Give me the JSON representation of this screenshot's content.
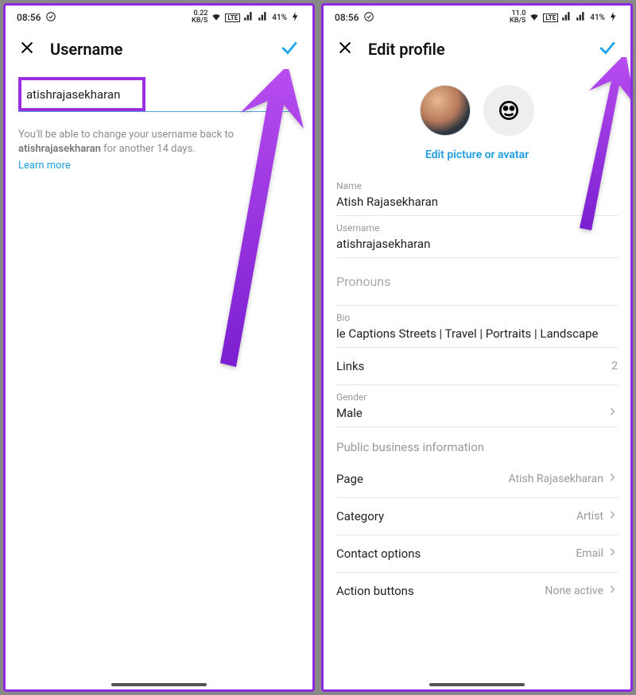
{
  "status": {
    "time": "08:56",
    "speed_left": "0.22",
    "speed_right": "11.0",
    "speed_unit": "KB/S",
    "battery": "41%"
  },
  "left": {
    "title": "Username",
    "username": "atishrajasekharan",
    "hint_prefix": "You'll be able to change your username back to ",
    "hint_bold": "atishrajasekharan",
    "hint_suffix": " for another 14 days.",
    "learn_more": "Learn more"
  },
  "right": {
    "title": "Edit profile",
    "edit_pic": "Edit picture or avatar",
    "fields": {
      "name_label": "Name",
      "name_value": "Atish Rajasekharan",
      "username_label": "Username",
      "username_value": "atishrajasekharan",
      "pronouns_placeholder": "Pronouns",
      "bio_label": "Bio",
      "bio_value": "le Captions Streets | Travel | Portraits | Landscape",
      "links_label": "Links",
      "links_count": "2",
      "gender_label": "Gender",
      "gender_value": "Male",
      "section": "Public business information",
      "page_label": "Page",
      "page_value": "Atish Rajasekharan",
      "category_label": "Category",
      "category_value": "Artist",
      "contact_label": "Contact options",
      "contact_value": "Email",
      "action_label": "Action buttons",
      "action_value": "None active"
    }
  }
}
